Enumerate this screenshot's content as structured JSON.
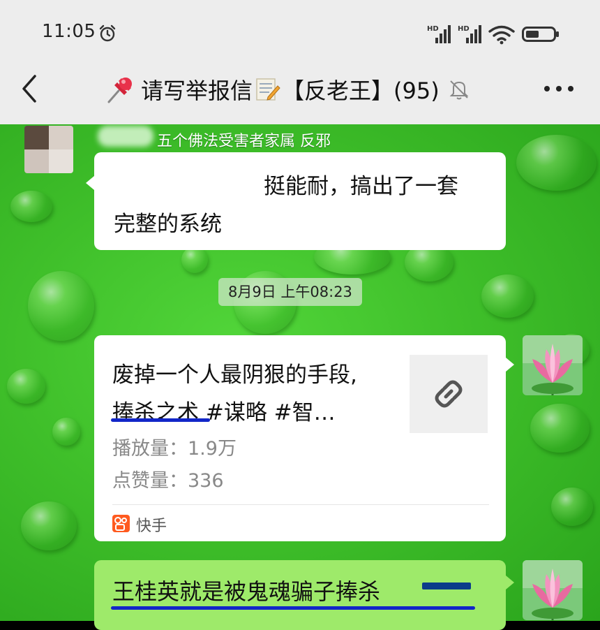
{
  "status_bar": {
    "time": "11:05",
    "hd1": "HD",
    "hd2": "HD"
  },
  "header": {
    "title": "请写举报信",
    "title_suffix": "【反老王】(95)"
  },
  "messages": {
    "sender_name": "五个佛法受害者家属 反邪",
    "msg1_line1": "挺能耐，搞出了一套",
    "msg1_line2": "完整的系统",
    "timestamp": "8月9日 上午08:23",
    "card": {
      "title_line1": "废掉一个人最阴狠的手段,",
      "title_line2": "捧杀之术 #谋略 #智…",
      "plays": "播放量：1.9万",
      "likes": "点赞量：336",
      "source": "快手"
    },
    "msg3_text": "王桂英就是被鬼魂骗子捧杀"
  },
  "colors": {
    "accent_underline": "#1226c8",
    "sent_bubble": "#9eea6a",
    "chat_background": "#3fbf2a",
    "kuaishou_brand": "#ff5a1f"
  },
  "icons": [
    "alarm-icon",
    "signal-icon",
    "wifi-icon",
    "battery-icon",
    "back-icon",
    "pin-icon",
    "memo-icon",
    "mute-icon",
    "more-icon",
    "link-icon",
    "kuaishou-icon"
  ]
}
